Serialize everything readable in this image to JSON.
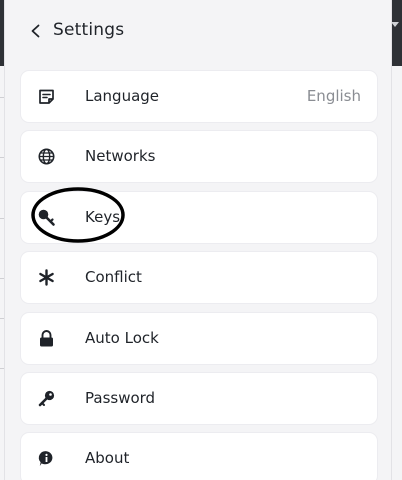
{
  "header": {
    "title": "Settings",
    "back_icon": "chevron-left-icon"
  },
  "settings": {
    "items": [
      {
        "label": "Language",
        "value": "English",
        "icon": "note-icon"
      },
      {
        "label": "Networks",
        "icon": "globe-icon"
      },
      {
        "label": "Keys",
        "icon": "key-icon"
      },
      {
        "label": "Conflict",
        "icon": "asterisk-icon"
      },
      {
        "label": "Auto Lock",
        "icon": "lock-icon"
      },
      {
        "label": "Password",
        "icon": "password-key-icon"
      },
      {
        "label": "About",
        "icon": "info-icon"
      }
    ]
  },
  "colors": {
    "panel_bg": "#f4f4f6",
    "item_bg": "#ffffff",
    "text": "#1f2329",
    "muted": "#8a8d93",
    "annotation": "#000000"
  }
}
